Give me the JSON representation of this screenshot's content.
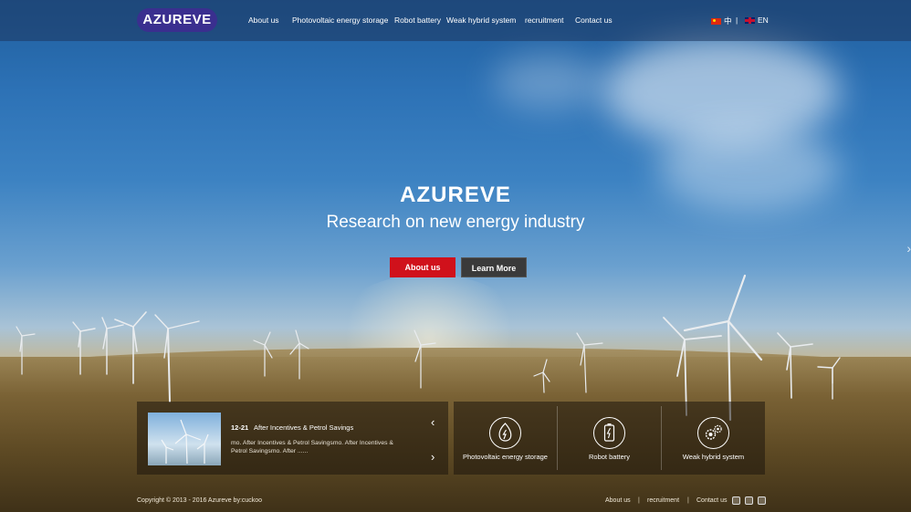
{
  "header": {
    "logo": "AZUREVE",
    "nav": [
      "About us",
      "Photovoltaic energy storage",
      "Robot battery",
      "Weak hybrid system",
      "recruitment",
      "Contact us"
    ],
    "lang_cn": "中",
    "lang_sep": "|",
    "lang_en": "EN"
  },
  "hero": {
    "title": "AZUREVE",
    "subtitle": "Research on new energy industry",
    "btn_about": "About us",
    "btn_learn": "Learn More"
  },
  "news": {
    "date": "12-21",
    "title": "After Incentives & Petrol Savings",
    "text": "mo. After Incentives & Petrol Savingsmo. After Incentives & Petrol Savingsmo. After ......"
  },
  "features": [
    {
      "label": "Photovoltaic energy storage",
      "icon": "leaf-energy-icon"
    },
    {
      "label": "Robot battery",
      "icon": "battery-icon"
    },
    {
      "label": "Weak hybrid system",
      "icon": "gears-icon"
    }
  ],
  "footer": {
    "copyright": "Copyright © 2013 - 2016 Azureve by:cuckoo",
    "links": [
      "About us",
      "recruitment",
      "Contact us"
    ],
    "sep": "|"
  },
  "colors": {
    "primary_button": "#d0111b",
    "secondary_button": "#3a3a3a",
    "logo_bg": "#3a2f8f"
  }
}
